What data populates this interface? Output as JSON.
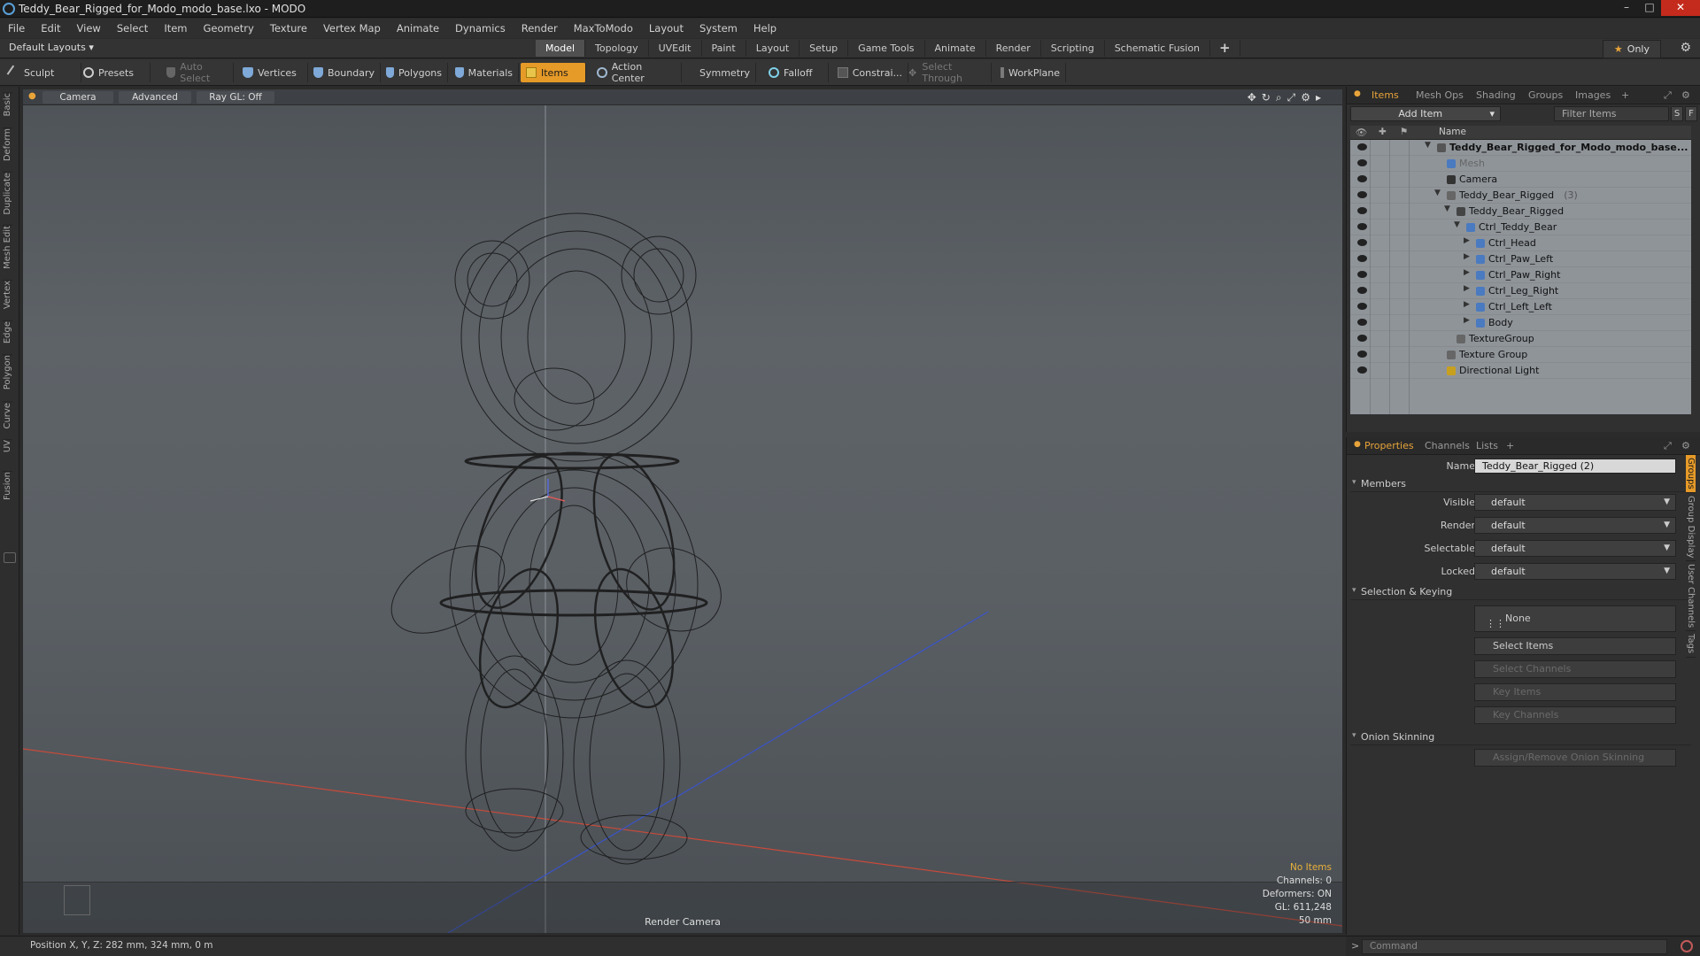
{
  "title": "Teddy_Bear_Rigged_for_Modo_modo_base.lxo - MODO",
  "menu": [
    "File",
    "Edit",
    "View",
    "Select",
    "Item",
    "Geometry",
    "Texture",
    "Vertex Map",
    "Animate",
    "Dynamics",
    "Render",
    "MaxToModo",
    "Layout",
    "System",
    "Help"
  ],
  "layouts": {
    "default_layouts": "Default Layouts",
    "tabs": [
      "Model",
      "Topology",
      "UVEdit",
      "Paint",
      "Layout",
      "Setup",
      "Game Tools",
      "Animate",
      "Render",
      "Scripting",
      "Schematic Fusion"
    ],
    "active_tab": "Model",
    "only": "Only"
  },
  "toolbar": {
    "sculpt": "Sculpt",
    "presets": "Presets",
    "auto_select": "Auto Select",
    "vertices": "Vertices",
    "boundary": "Boundary",
    "polygons": "Polygons",
    "materials": "Materials",
    "items": "Items",
    "action_center": "Action Center",
    "symmetry": "Symmetry",
    "falloff": "Falloff",
    "constrain": "Constrai...",
    "select_through": "Select Through",
    "workplane": "WorkPlane"
  },
  "left_tabs": [
    "Basic",
    "Deform",
    "Duplicate",
    "Mesh Edit",
    "Vertex",
    "Edge",
    "Polygon",
    "Curve",
    "UV",
    "Fusion"
  ],
  "viewport": {
    "camera": "Camera",
    "advanced": "Advanced",
    "raygl": "Ray GL: Off",
    "render_camera": "Render Camera",
    "stats": {
      "no_items": "No Items",
      "channels": "Channels: 0",
      "deformers": "Deformers: ON",
      "gl": "GL: 611,248",
      "focal": "50 mm"
    }
  },
  "statusbar": {
    "position": "Position X, Y, Z:  282 mm, 324 mm, 0 m"
  },
  "items_panel": {
    "tabs": [
      "Items",
      "Mesh Ops",
      "Shading",
      "Groups",
      "Images"
    ],
    "add_item": "Add Item",
    "filter": "Filter Items",
    "s": "S",
    "f": "F",
    "name_col": "Name",
    "tree": [
      {
        "label": "Teddy_Bear_Rigged_for_Modo_modo_base...",
        "depth": 0,
        "bold": true,
        "expand": "▼",
        "icon": "scene-icon"
      },
      {
        "label": "Mesh",
        "depth": 1,
        "dim": true,
        "expand": "",
        "icon": "mesh-icon"
      },
      {
        "label": "Camera",
        "depth": 1,
        "expand": "",
        "icon": "camera-icon"
      },
      {
        "label": "Teddy_Bear_Rigged",
        "count": "(3)",
        "depth": 1,
        "expand": "▼",
        "icon": "group-icon"
      },
      {
        "label": "Teddy_Bear_Rigged",
        "depth": 2,
        "expand": "▼",
        "icon": "locator-icon"
      },
      {
        "label": "Ctrl_Teddy_Bear",
        "depth": 3,
        "expand": "▼",
        "icon": "mesh-icon"
      },
      {
        "label": "Ctrl_Head",
        "depth": 4,
        "expand": "▶",
        "icon": "mesh-icon"
      },
      {
        "label": "Ctrl_Paw_Left",
        "depth": 4,
        "expand": "▶",
        "icon": "mesh-icon"
      },
      {
        "label": "Ctrl_Paw_Right",
        "depth": 4,
        "expand": "▶",
        "icon": "mesh-icon"
      },
      {
        "label": "Ctrl_Leg_Right",
        "depth": 4,
        "expand": "▶",
        "icon": "mesh-icon"
      },
      {
        "label": "Ctrl_Left_Left",
        "depth": 4,
        "expand": "▶",
        "icon": "mesh-icon"
      },
      {
        "label": "Body",
        "depth": 4,
        "expand": "▶",
        "icon": "mesh-icon"
      },
      {
        "label": "TextureGroup",
        "depth": 2,
        "expand": "",
        "icon": "group-icon"
      },
      {
        "label": "Texture Group",
        "depth": 1,
        "expand": "",
        "icon": "group-icon"
      },
      {
        "label": "Directional Light",
        "depth": 1,
        "expand": "",
        "icon": "light-icon"
      }
    ]
  },
  "properties": {
    "tabs": [
      "Properties",
      "Channels",
      "Lists"
    ],
    "name_label": "Name",
    "name_value": "Teddy_Bear_Rigged (2)",
    "members": "Members",
    "visible_label": "Visible",
    "visible": "default",
    "render_label": "Render",
    "render": "default",
    "selectable_label": "Selectable",
    "selectable": "default",
    "locked_label": "Locked",
    "locked": "default",
    "sel_keying": "Selection & Keying",
    "none": "None",
    "select_items": "Select Items",
    "select_channels": "Select Channels",
    "key_items": "Key Items",
    "key_channels": "Key Channels",
    "onion": "Onion Skinning",
    "assign_onion": "Assign/Remove Onion Skinning",
    "side_tabs": [
      "Groups",
      "Group Display",
      "User Channels",
      "Tags"
    ]
  },
  "command": {
    "placeholder": "Command"
  }
}
